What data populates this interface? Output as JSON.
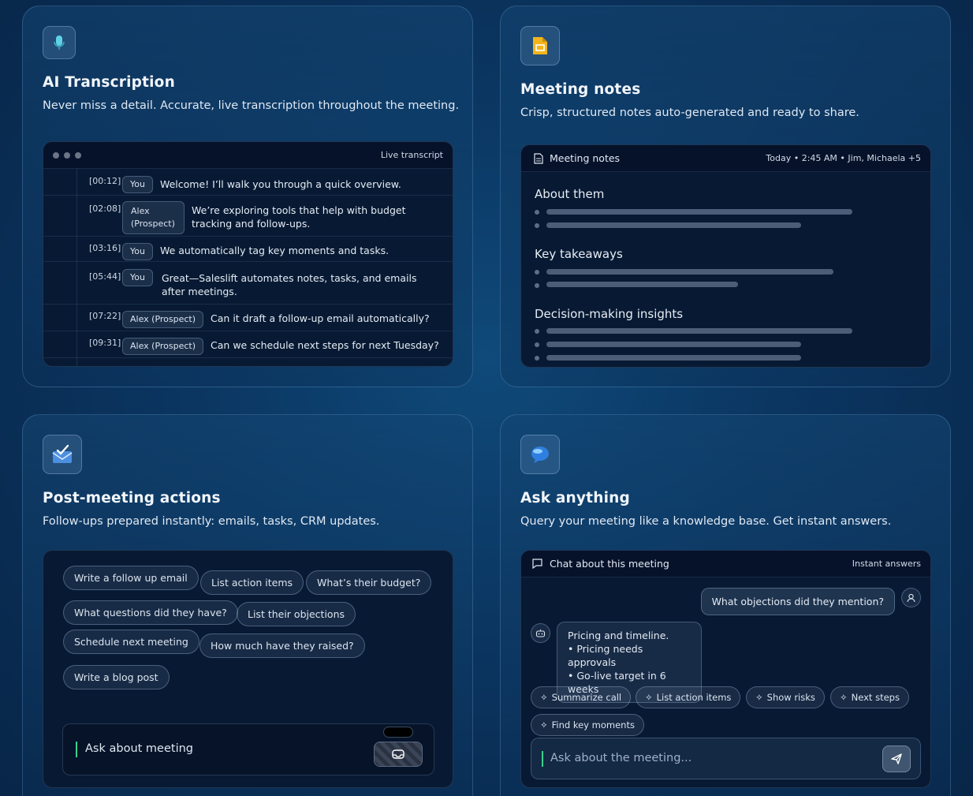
{
  "transcription": {
    "title": "AI Transcription",
    "subtitle": "Never miss a detail. Accurate, live transcription throughout the meeting.",
    "panel_label": "Live transcript",
    "rows": [
      {
        "time": "[00:12]",
        "speaker": "You",
        "text": "Welcome! I’ll walk you through a quick overview."
      },
      {
        "time": "[02:08]",
        "speaker": "Alex (Prospect)",
        "text": "We’re exploring tools that help with budget tracking and follow-ups."
      },
      {
        "time": "[03:16]",
        "speaker": "You",
        "text": "We automatically tag key moments and tasks."
      },
      {
        "time": "[05:44]",
        "speaker": "You",
        "text": "Great—Saleslift automates notes, tasks, and emails after meetings."
      },
      {
        "time": "[07:22]",
        "speaker": "Alex (Prospect)",
        "text": "Can it draft a follow-up email automatically?"
      },
      {
        "time": "[09:31]",
        "speaker": "Alex (Prospect)",
        "text": "Can we schedule next steps for next Tuesday?"
      }
    ]
  },
  "notes": {
    "title": "Meeting notes",
    "subtitle": "Crisp, structured notes auto-generated and ready to share.",
    "panel_label": "Meeting notes",
    "meta": "Today • 2:45 AM • Jim, Michaela +5",
    "sections": [
      "About them",
      "Key takeaways",
      "Decision-making insights"
    ]
  },
  "actions": {
    "title": "Post-meeting actions",
    "subtitle": "Follow-ups prepared instantly: emails, tasks, CRM updates.",
    "chips": [
      "Write a follow up email",
      "List action items",
      "What’s their budget?",
      "What questions did they have?",
      "List their objections",
      "Schedule next meeting",
      "How much have they raised?",
      "Write a blog post"
    ],
    "input_text": "Ask about meeting"
  },
  "ask": {
    "title": "Ask anything",
    "subtitle": "Query your meeting like a knowledge base. Get instant answers.",
    "panel_label": "Chat about this meeting",
    "panel_meta": "Instant answers",
    "user_message": "What objections did they mention?",
    "bot_lines": [
      "Pricing and timeline.",
      "• Pricing needs approvals",
      "• Go-live target in 6 weeks"
    ],
    "quick_actions": [
      "Summarize call",
      "List action items",
      "Show risks",
      "Next steps",
      "Find key moments"
    ],
    "input_placeholder": "Ask about the meeting..."
  },
  "colors": {
    "background": "#0b3763",
    "panel": "#081a33",
    "caret_accent": "#3ad18d",
    "slides_icon": "#f2b51c"
  },
  "icons": {
    "transcription": "microphone-icon",
    "notes": "slides-icon",
    "actions": "mail-check-icon",
    "ask": "globe-chat-icon"
  }
}
